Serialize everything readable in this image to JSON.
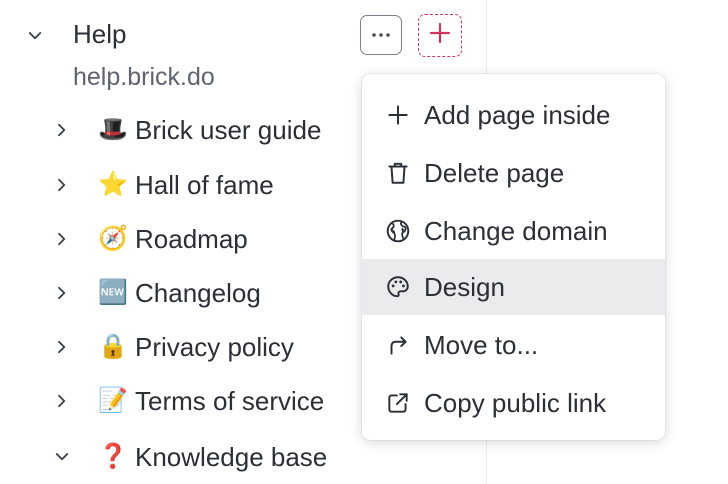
{
  "sidebar": {
    "root": {
      "title": "Help",
      "domain": "help.brick.do",
      "more_icon": "ellipsis-icon",
      "add_icon": "plus-icon"
    },
    "items": [
      {
        "emoji": "🎩",
        "label": "Brick user guide",
        "expanded": false
      },
      {
        "emoji": "⭐",
        "label": "Hall of fame",
        "expanded": false
      },
      {
        "emoji": "🧭",
        "label": "Roadmap",
        "expanded": false
      },
      {
        "emoji": "🆕",
        "label": "Changelog",
        "expanded": false
      },
      {
        "emoji": "🔒",
        "label": "Privacy policy",
        "expanded": false
      },
      {
        "emoji": "📝",
        "label": "Terms of service",
        "expanded": false
      },
      {
        "emoji": "❓",
        "label": "Knowledge base",
        "expanded": true
      }
    ]
  },
  "context_menu": {
    "items": [
      {
        "icon": "plus-icon",
        "label": "Add page inside"
      },
      {
        "icon": "trash-icon",
        "label": "Delete page"
      },
      {
        "icon": "globe-icon",
        "label": "Change domain"
      },
      {
        "icon": "palette-icon",
        "label": "Design",
        "highlighted": true
      },
      {
        "icon": "arrow-forward-icon",
        "label": "Move to..."
      },
      {
        "icon": "external-link-icon",
        "label": "Copy public link"
      }
    ]
  },
  "colors": {
    "accent_dashed": "#d1365f",
    "text": "#2b2f36",
    "muted": "#5e6470",
    "highlight": "#ebebee"
  }
}
